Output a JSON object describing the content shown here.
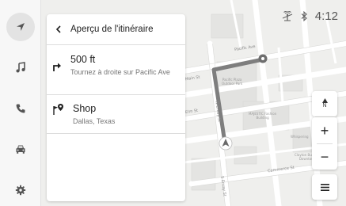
{
  "status": {
    "time": "4:12",
    "icons": [
      "antenna-off-icon",
      "bluetooth-icon"
    ]
  },
  "rail": {
    "items": [
      {
        "name": "navigation-icon",
        "active": true
      },
      {
        "name": "music-note-icon",
        "active": false
      },
      {
        "name": "phone-icon",
        "active": false
      },
      {
        "name": "car-icon",
        "active": false
      },
      {
        "name": "gear-icon",
        "active": false
      }
    ]
  },
  "panel": {
    "title": "Aperçu de l'itinéraire",
    "back_icon": "chevron-left-icon",
    "step": {
      "distance": "500 ft",
      "instruction": "Tournez à droite sur Pacific Ave",
      "icon": "turn-right-icon"
    },
    "destination": {
      "name": "Shop",
      "address": "Dallas, Texas",
      "icon": "destination-flag-icon"
    }
  },
  "map": {
    "streets": [
      "Pacific Ave",
      "Main St",
      "Elm St",
      "N Ervay St",
      "Commerce St",
      "S Ervay St"
    ],
    "buildings": [
      "Pacific Plaza\nOutdoor Park",
      "MAJESTIC Fashion\nBuilding",
      "Clayton Building\nDowntown",
      "Whispering"
    ],
    "controls": {
      "compass_label": "N",
      "zoom_in": "+",
      "zoom_out": "−",
      "menu_icon": "hamburger-menu-icon"
    }
  },
  "colors": {
    "route": "#8a8a8a",
    "map_bg": "#f1f1ef",
    "road": "#ffffff",
    "panel_bg": "#ffffff"
  }
}
